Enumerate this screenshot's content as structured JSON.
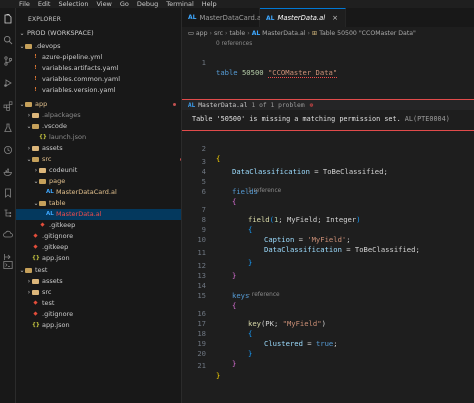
{
  "menu": [
    "File",
    "Edit",
    "Selection",
    "View",
    "Go",
    "Debug",
    "Terminal",
    "Help"
  ],
  "sidebar": {
    "title": "EXPLORER",
    "workspace": "PROD (WORKSPACE)",
    "tree": [
      {
        "label": ".devops",
        "type": "folder",
        "open": true
      },
      {
        "label": "azure-pipeline.yml",
        "type": "yaml"
      },
      {
        "label": "variables.artifacts.yaml",
        "type": "yaml"
      },
      {
        "label": "variables.common.yaml",
        "type": "yaml"
      },
      {
        "label": "variables.version.yaml",
        "type": "yaml"
      },
      {
        "label": "app",
        "type": "folder",
        "open": true
      },
      {
        "label": ".alpackages",
        "type": "folder"
      },
      {
        "label": ".vscode",
        "type": "folder",
        "open": true
      },
      {
        "label": "launch.json",
        "type": "json"
      },
      {
        "label": "assets",
        "type": "folder"
      },
      {
        "label": "src",
        "type": "folder",
        "open": true
      },
      {
        "label": "codeunit",
        "type": "folder"
      },
      {
        "label": "page",
        "type": "folder",
        "open": true
      },
      {
        "label": "MasterDataCard.al",
        "type": "al",
        "badge": "4, U"
      },
      {
        "label": "table",
        "type": "folder",
        "open": true
      },
      {
        "label": "MasterData.al",
        "type": "al",
        "badge": "1, U"
      },
      {
        "label": ".gitkeep",
        "type": "git"
      },
      {
        "label": ".gitignore",
        "type": "git"
      },
      {
        "label": ".gitkeep",
        "type": "git"
      },
      {
        "label": "app.json",
        "type": "json"
      },
      {
        "label": "test",
        "type": "folder",
        "open": true
      },
      {
        "label": "assets",
        "type": "folder"
      },
      {
        "label": "src",
        "type": "folder"
      },
      {
        "label": "test",
        "type": "git"
      },
      {
        "label": ".gitignore",
        "type": "git"
      },
      {
        "label": "app.json",
        "type": "json"
      }
    ]
  },
  "tabs": [
    {
      "label": "MasterDataCard.al",
      "active": false
    },
    {
      "label": "MasterData.al",
      "active": true,
      "close": "×"
    }
  ],
  "al_badge": "AL",
  "breadcrumb": [
    "app",
    "src",
    "table",
    "MasterData.al",
    "Table 50500 \"CCOMaster Data\""
  ],
  "codelens_top": "0 references",
  "codelens_field": "1 reference",
  "codelens_key": "- reference",
  "problem_peek": {
    "file": "MasterData.al",
    "counter": "1 of 1 problem",
    "message": "Table '50500' is missing a matching permission set.",
    "code": "AL(PTE0004)"
  },
  "code": {
    "line1": {
      "no": "1",
      "kw": "table",
      "num": "50500",
      "str": "\"CCOMaster Data\""
    },
    "line2": {
      "no": "2",
      "text": "{"
    },
    "line3": {
      "no": "3",
      "prop": "DataClassification",
      "eq": " = ",
      "val": "ToBeClassified",
      "semi": ";"
    },
    "line4": {
      "no": "4",
      "text": ""
    },
    "line5": {
      "no": "5",
      "kw": "fields"
    },
    "line6": {
      "no": "6",
      "text": "{"
    },
    "line7": {
      "no": "7",
      "fn": "field",
      "args1": "(",
      "num": "1",
      "args2": "; MyField; ",
      "type": "Integer",
      "args3": ")"
    },
    "line8": {
      "no": "8",
      "text": "{"
    },
    "line9": {
      "no": "9",
      "prop": "Caption",
      "eq": " = ",
      "str": "'MyField'",
      "semi": ";"
    },
    "line10": {
      "no": "10",
      "prop": "DataClassification",
      "eq": " = ",
      "val": "ToBeClassified",
      "semi": ";"
    },
    "line11": {
      "no": "11",
      "text": "}"
    },
    "line12": {
      "no": "12",
      "text": "}"
    },
    "line13": {
      "no": "13",
      "text": ""
    },
    "line14": {
      "no": "14",
      "kw": "keys"
    },
    "line15": {
      "no": "15",
      "text": "{"
    },
    "line16": {
      "no": "16",
      "fn": "key",
      "args1": "(PK; ",
      "str": "\"MyField\"",
      "args2": ")"
    },
    "line17": {
      "no": "17",
      "text": "{"
    },
    "line18": {
      "no": "18",
      "prop": "Clustered",
      "eq": " = ",
      "val": "true",
      "semi": ";"
    },
    "line19": {
      "no": "19",
      "text": "}"
    },
    "line20": {
      "no": "20",
      "text": "}"
    },
    "line21": {
      "no": "21",
      "text": "}"
    }
  },
  "colors": {
    "accent": "#0078d4",
    "error": "#f14c4c",
    "untracked": "#73c991",
    "modified": "#e2c08d"
  }
}
